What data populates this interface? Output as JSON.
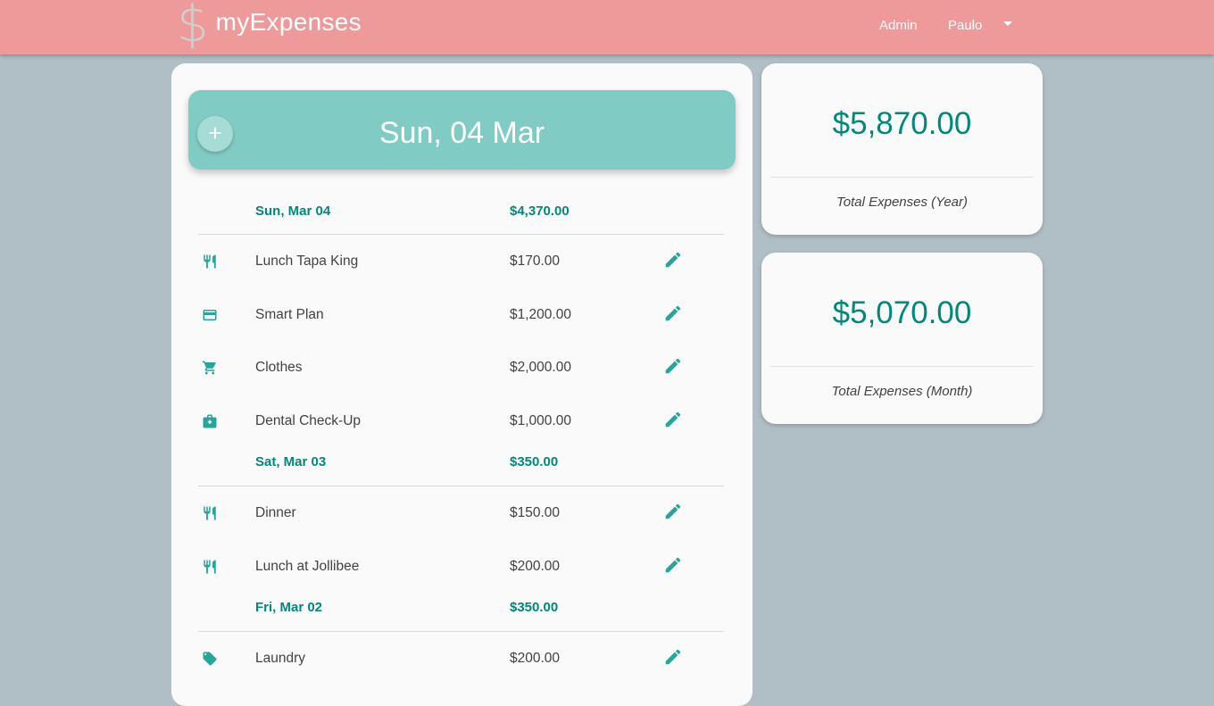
{
  "brand": {
    "icon": "$",
    "name": "myExpenses"
  },
  "nav": {
    "admin": "Admin",
    "user": "Paulo"
  },
  "header": {
    "add_label": "+",
    "date": "Sun, 04 Mar"
  },
  "groups": [
    {
      "date": "Sun, Mar 04",
      "total": "$4,370.00",
      "items": [
        {
          "icon": "restaurant-icon",
          "name": "Lunch Tapa King",
          "amount": "$170.00"
        },
        {
          "icon": "credit-card-icon",
          "name": "Smart Plan",
          "amount": "$1,200.00"
        },
        {
          "icon": "shopping-cart-icon",
          "name": "Clothes",
          "amount": "$2,000.00"
        },
        {
          "icon": "medical-bag-icon",
          "name": "Dental Check-Up",
          "amount": "$1,000.00"
        }
      ]
    },
    {
      "date": "Sat, Mar 03",
      "total": "$350.00",
      "items": [
        {
          "icon": "restaurant-icon",
          "name": "Dinner",
          "amount": "$150.00"
        },
        {
          "icon": "restaurant-icon",
          "name": "Lunch at Jollibee",
          "amount": "$200.00"
        }
      ]
    },
    {
      "date": "Fri, Mar 02",
      "total": "$350.00",
      "items": [
        {
          "icon": "tag-icon",
          "name": "Laundry",
          "amount": "$200.00"
        }
      ]
    }
  ],
  "stats": {
    "year": {
      "amount": "$5,870.00",
      "label": "Total Expenses (Year)"
    },
    "month": {
      "amount": "$5,070.00",
      "label": "Total Expenses (Month)"
    }
  },
  "colors": {
    "navbar": "#ef9a9a",
    "accent": "#00897b",
    "header": "#80cbc4",
    "background": "#b0bec5"
  }
}
